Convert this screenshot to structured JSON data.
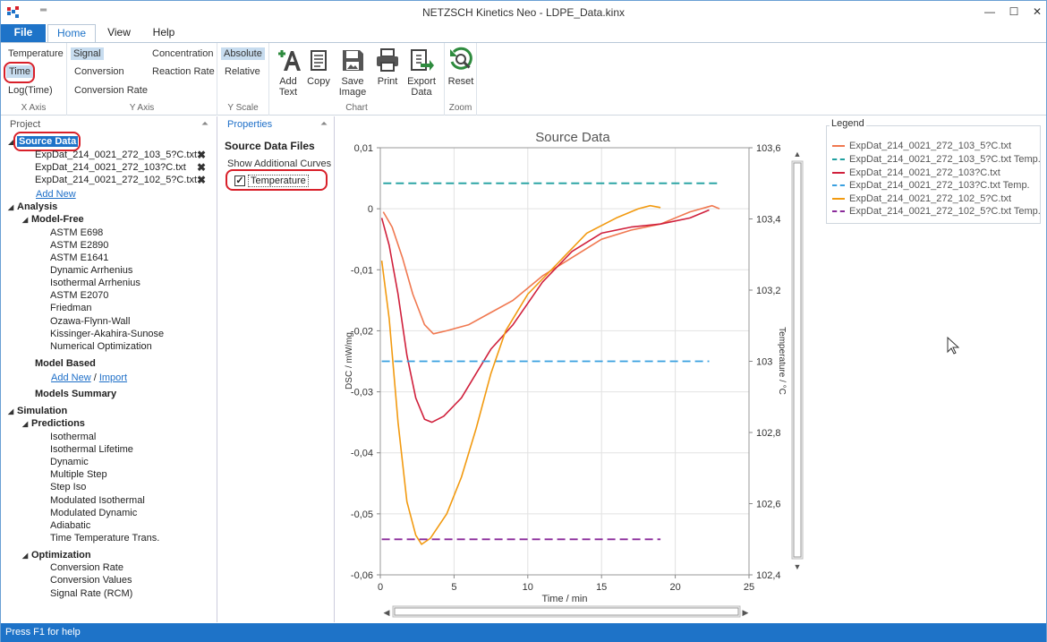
{
  "window": {
    "title": "NETZSCH Kinetics Neo - LDPE_Data.kinx",
    "qat": "═"
  },
  "tabs": [
    {
      "label": "File"
    },
    {
      "label": "Home"
    },
    {
      "label": "View"
    },
    {
      "label": "Help"
    }
  ],
  "ribbon": {
    "xaxis": {
      "label": "X Axis",
      "items": [
        "Temperature",
        "Time",
        "Log(Time)"
      ]
    },
    "yaxis": {
      "label": "Y Axis",
      "items": [
        "Signal",
        "Conversion",
        "Conversion Rate",
        "Concentration",
        "Reaction Rate"
      ]
    },
    "yscale": {
      "label": "Y Scale",
      "items": [
        "Absolute",
        "Relative"
      ]
    },
    "chart": {
      "label": "Chart",
      "buttons": [
        "Add Text",
        "Copy",
        "Save Image",
        "Print",
        "Export Data"
      ]
    },
    "zoom": {
      "label": "Zoom",
      "buttons": [
        "Reset"
      ]
    }
  },
  "project": {
    "header": "Project",
    "source_data": "Source Data",
    "files": [
      "ExpDat_214_0021_272_103_5?C.txt",
      "ExpDat_214_0021_272_103?C.txt",
      "ExpDat_214_0021_272_102_5?C.txt"
    ],
    "add_new": "Add New",
    "analysis": "Analysis",
    "model_free": "Model-Free",
    "model_free_items": [
      "ASTM E698",
      "ASTM E2890",
      "ASTM E1641",
      "Dynamic Arrhenius",
      "Isothermal Arrhenius",
      "ASTM E2070",
      "Friedman",
      "Ozawa-Flynn-Wall",
      "Kissinger-Akahira-Sunose",
      "Numerical Optimization"
    ],
    "model_based": "Model Based",
    "model_based_add": "Add New",
    "model_based_sep": "/",
    "model_based_import": "Import",
    "models_summary": "Models Summary",
    "simulation": "Simulation",
    "predictions": "Predictions",
    "predictions_items": [
      "Isothermal",
      "Isothermal Lifetime",
      "Dynamic",
      "Multiple Step",
      "Step Iso",
      "Modulated Isothermal",
      "Modulated Dynamic",
      "Adiabatic",
      "Time Temperature Trans."
    ],
    "optimization": "Optimization",
    "optimization_items": [
      "Conversion Rate",
      "Conversion Values",
      "Signal Rate (RCM)"
    ]
  },
  "properties": {
    "header": "Properties",
    "title": "Source Data Files",
    "show_curves": "Show Additional Curves",
    "checkbox_label": "Temperature",
    "checked": true
  },
  "legend": {
    "title": "Legend",
    "entries": [
      {
        "label": "ExpDat_214_0021_272_103_5?C.txt",
        "color": "#f07850",
        "dash": false
      },
      {
        "label": "ExpDat_214_0021_272_103_5?C.txt Temp.",
        "color": "#20a0a0",
        "dash": true
      },
      {
        "label": "ExpDat_214_0021_272_103?C.txt",
        "color": "#d0203c",
        "dash": false
      },
      {
        "label": "ExpDat_214_0021_272_103?C.txt Temp.",
        "color": "#3aa0e0",
        "dash": true
      },
      {
        "label": "ExpDat_214_0021_272_102_5?C.txt",
        "color": "#f29a10",
        "dash": false
      },
      {
        "label": "ExpDat_214_0021_272_102_5?C.txt Temp.",
        "color": "#8a2a9a",
        "dash": true
      }
    ]
  },
  "chart_data": {
    "type": "line",
    "title": "Source Data",
    "xlabel": "Time / min",
    "ylabel": "DSC / mW/mg",
    "y2label": "Temperature / °C",
    "xlim": [
      0,
      25
    ],
    "ylim": [
      -0.06,
      0.01
    ],
    "y2lim": [
      102.4,
      103.6
    ],
    "xticks": [
      "0",
      "5",
      "10",
      "15",
      "20",
      "25"
    ],
    "yticks": [
      "0,01",
      "0",
      "-0,01",
      "-0,02",
      "-0,03",
      "-0,04",
      "-0,05",
      "-0,06"
    ],
    "y2ticks": [
      "103,6",
      "103,4",
      "103,2",
      "103",
      "102,8",
      "102,6",
      "102,4"
    ],
    "grid": true,
    "series": [
      {
        "name": "ExpDat_214_0021_272_103_5?C.txt",
        "axis": "left",
        "color": "#f07850",
        "dash": false,
        "points": [
          [
            0.2,
            -0.0005
          ],
          [
            0.8,
            -0.003
          ],
          [
            1.5,
            -0.008
          ],
          [
            2.2,
            -0.014
          ],
          [
            3,
            -0.019
          ],
          [
            3.6,
            -0.0205
          ],
          [
            4.5,
            -0.02
          ],
          [
            6,
            -0.019
          ],
          [
            7.5,
            -0.017
          ],
          [
            9,
            -0.015
          ],
          [
            11,
            -0.011
          ],
          [
            13,
            -0.008
          ],
          [
            15,
            -0.005
          ],
          [
            17,
            -0.0035
          ],
          [
            19,
            -0.0025
          ],
          [
            21,
            -0.0005
          ],
          [
            22.5,
            0.0005
          ],
          [
            23,
            0
          ]
        ]
      },
      {
        "name": "ExpDat_214_0021_272_103_5?C.txt Temp.",
        "axis": "right",
        "color": "#20a0a0",
        "dash": true,
        "points": [
          [
            0.2,
            103.5
          ],
          [
            23,
            103.5
          ]
        ]
      },
      {
        "name": "ExpDat_214_0021_272_103?C.txt",
        "axis": "left",
        "color": "#d0203c",
        "dash": false,
        "points": [
          [
            0.1,
            -0.0015
          ],
          [
            0.6,
            -0.006
          ],
          [
            1.2,
            -0.014
          ],
          [
            1.8,
            -0.024
          ],
          [
            2.4,
            -0.031
          ],
          [
            3,
            -0.0345
          ],
          [
            3.5,
            -0.035
          ],
          [
            4.3,
            -0.034
          ],
          [
            5.5,
            -0.031
          ],
          [
            6.5,
            -0.027
          ],
          [
            7.5,
            -0.023
          ],
          [
            9,
            -0.019
          ],
          [
            11,
            -0.012
          ],
          [
            13,
            -0.007
          ],
          [
            15,
            -0.004
          ],
          [
            17,
            -0.003
          ],
          [
            19,
            -0.0025
          ],
          [
            21,
            -0.0015
          ],
          [
            22.3,
            -0.0002
          ]
        ]
      },
      {
        "name": "ExpDat_214_0021_272_103?C.txt Temp.",
        "axis": "right",
        "color": "#3aa0e0",
        "dash": true,
        "points": [
          [
            0.1,
            103
          ],
          [
            22.3,
            103
          ]
        ]
      },
      {
        "name": "ExpDat_214_0021_272_102_5?C.txt",
        "axis": "left",
        "color": "#f29a10",
        "dash": false,
        "points": [
          [
            0.1,
            -0.0085
          ],
          [
            0.6,
            -0.018
          ],
          [
            1.2,
            -0.035
          ],
          [
            1.8,
            -0.048
          ],
          [
            2.4,
            -0.0535
          ],
          [
            2.8,
            -0.055
          ],
          [
            3.4,
            -0.054
          ],
          [
            4.5,
            -0.05
          ],
          [
            5.5,
            -0.044
          ],
          [
            6.5,
            -0.036
          ],
          [
            7.5,
            -0.027
          ],
          [
            8.5,
            -0.02
          ],
          [
            10,
            -0.014
          ],
          [
            12,
            -0.009
          ],
          [
            14,
            -0.004
          ],
          [
            16,
            -0.0015
          ],
          [
            17.5,
            0
          ],
          [
            18.3,
            0.0005
          ],
          [
            19,
            0.0002
          ]
        ]
      },
      {
        "name": "ExpDat_214_0021_272_102_5?C.txt Temp.",
        "axis": "right",
        "color": "#8a2a9a",
        "dash": true,
        "points": [
          [
            0.1,
            102.5
          ],
          [
            19,
            102.5
          ]
        ]
      }
    ]
  },
  "status": "Press F1 for help"
}
